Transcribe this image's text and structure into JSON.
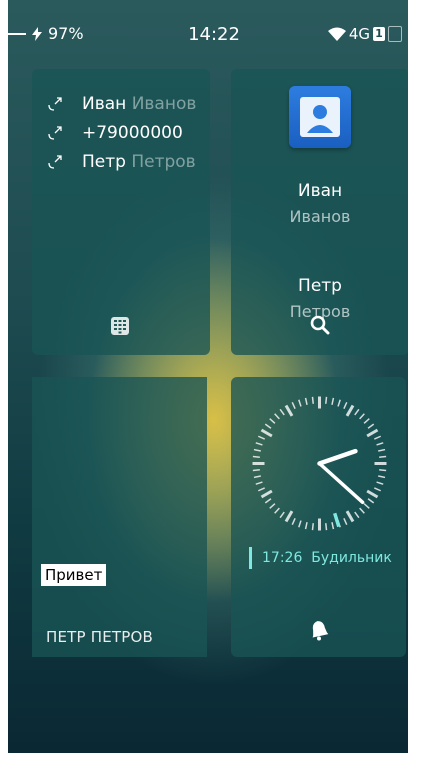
{
  "status_bar": {
    "battery": "97%",
    "time": "14:22",
    "network": "4G",
    "sim_slot": "1"
  },
  "recents": {
    "calls": [
      {
        "first": "Иван",
        "last": "Иванов"
      },
      {
        "first": "+79000000",
        "last": ""
      },
      {
        "first": "Петр",
        "last": "Петров"
      }
    ],
    "icon": "dialpad-icon"
  },
  "contacts": {
    "items": [
      {
        "first": "Иван",
        "last": "Иванов"
      },
      {
        "first": "Петр",
        "last": "Петров"
      }
    ],
    "icon": "search-icon"
  },
  "message": {
    "text": "Привет",
    "sender": "ПЕТР ПЕТРОВ"
  },
  "clock": {
    "alarm_time": "17:26",
    "alarm_label": "Будильник",
    "accent": "#7fe8e0"
  }
}
